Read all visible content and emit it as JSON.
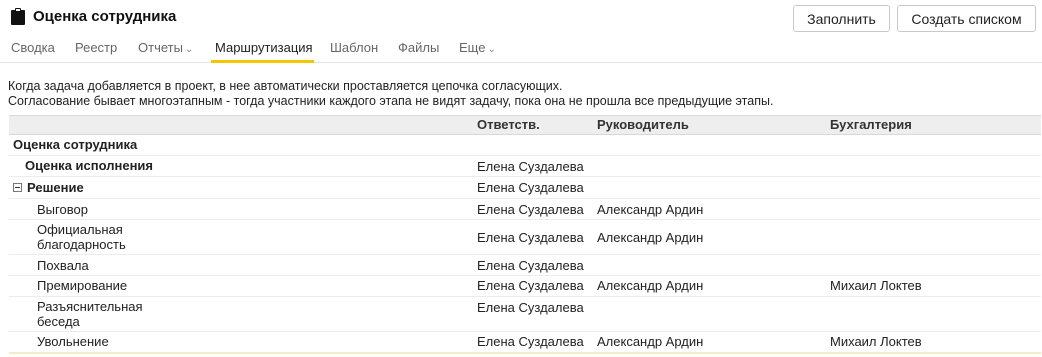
{
  "header": {
    "title": "Оценка сотрудника",
    "fill_button": "Заполнить",
    "create_list_button": "Создать списком"
  },
  "tabs": [
    {
      "label": "Сводка",
      "dropdown": false
    },
    {
      "label": "Реестр",
      "dropdown": false
    },
    {
      "label": "Отчеты",
      "dropdown": true
    },
    {
      "label": "Маршрутизация",
      "dropdown": false,
      "active": true
    },
    {
      "label": "Шаблон",
      "dropdown": false
    },
    {
      "label": "Файлы",
      "dropdown": false
    },
    {
      "label": "Еще",
      "dropdown": true
    }
  ],
  "description": {
    "line1": "Когда задача добавляется в проект, в нее автоматически проставляется цепочка согласующих.",
    "line2": "Согласование бывает многоэтапным - тогда участники каждого этапа не видят задачу, пока она не прошла все предыдущие этапы."
  },
  "table": {
    "columns": {
      "name": "",
      "responsible": "Ответств.",
      "manager": "Руководитель",
      "accounting": "Бухгалтерия"
    },
    "rows": [
      {
        "name": "Оценка сотрудника",
        "responsible": "",
        "manager": "",
        "accounting": ""
      },
      {
        "name": "Оценка исполнения",
        "responsible": "Елена Суздалева",
        "manager": "",
        "accounting": ""
      },
      {
        "name": "Решение",
        "responsible": "Елена Суздалева",
        "manager": "",
        "accounting": ""
      },
      {
        "name": "Выговор",
        "responsible": "Елена Суздалева",
        "manager": "Александр Ардин",
        "accounting": ""
      },
      {
        "name": "Официальная благодарность",
        "name_line1": "Официальная",
        "name_line2": "благодарность",
        "responsible": "Елена Суздалева",
        "manager": "Александр Ардин",
        "accounting": ""
      },
      {
        "name": "Похвала",
        "responsible": "Елена Суздалева",
        "manager": "",
        "accounting": ""
      },
      {
        "name": "Премирование",
        "responsible": "Елена Суздалева",
        "manager": "Александр Ардин",
        "accounting": "Михаил Локтев"
      },
      {
        "name": "Разъяснительная беседа",
        "name_line1": "Разъяснительная",
        "name_line2": "беседа",
        "responsible": "Елена Суздалева",
        "manager": "",
        "accounting": ""
      },
      {
        "name": "Увольнение",
        "responsible": "Елена Суздалева",
        "manager": "Александр Ардин",
        "accounting": "Михаил Локтев"
      }
    ]
  },
  "colors": {
    "accent": "#f2c700",
    "header_bg": "#eeeeee"
  },
  "icons": {
    "title_icon": "clipboard-icon",
    "expand_toggle": "collapse-minus-icon",
    "dropdown": "chevron-down-icon"
  }
}
